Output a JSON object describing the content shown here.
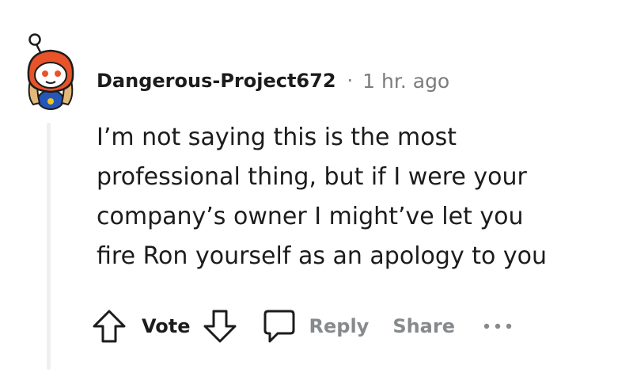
{
  "comment": {
    "username": "Dangerous-Project672",
    "separator": "·",
    "timestamp": "1 hr. ago",
    "body_lines": [
      "I’m not saying this is the most",
      "professional thing, but if I were your",
      "company’s owner I might’ve let you",
      "fire Ron yourself as an apology to you"
    ]
  },
  "actions": {
    "upvote_icon": "arrow-up-outline-icon",
    "vote_label": "Vote",
    "downvote_icon": "arrow-down-outline-icon",
    "reply_icon": "speech-bubble-icon",
    "reply_label": "Reply",
    "share_label": "Share",
    "more_icon": "ellipsis-icon"
  },
  "colors": {
    "text": "#1c1c1c",
    "muted": "#878a8c",
    "thread_line": "#edeff1",
    "avatar_hood": "#e8532a"
  }
}
